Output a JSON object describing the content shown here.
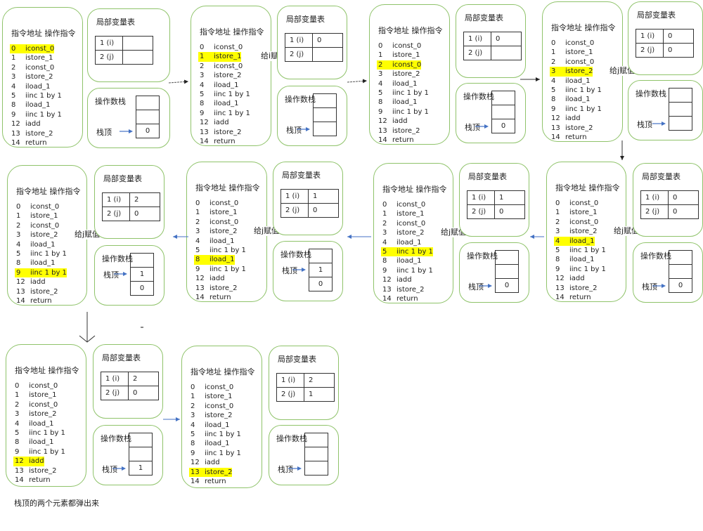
{
  "labels": {
    "code_header": "指令地址 操作指令",
    "locals_title": "局部变量表",
    "stack_title": "操作数栈",
    "stack_top": "栈顶",
    "slot_i": "1 (i)",
    "slot_j": "2 (j)"
  },
  "instructions": [
    {
      "addr": "0",
      "op": "iconst_0"
    },
    {
      "addr": "1",
      "op": "istore_1"
    },
    {
      "addr": "2",
      "op": "iconst_0"
    },
    {
      "addr": "3",
      "op": "istore_2"
    },
    {
      "addr": "4",
      "op": "iload_1"
    },
    {
      "addr": "5",
      "op": "iinc 1 by 1"
    },
    {
      "addr": "8",
      "op": "iload_1"
    },
    {
      "addr": "9",
      "op": "iinc 1 by 1"
    },
    {
      "addr": "12",
      "op": "iadd"
    },
    {
      "addr": "13",
      "op": "istore_2"
    },
    {
      "addr": "14",
      "op": "return"
    }
  ],
  "steps": [
    {
      "id": 1,
      "highlight": 0,
      "note": null,
      "i": "",
      "j": "",
      "stack": [
        "",
        "",
        "0"
      ],
      "top_row": 2
    },
    {
      "id": 2,
      "highlight": 1,
      "note": {
        "row": 1,
        "text": "给i赋值"
      },
      "i": "0",
      "j": "",
      "stack": [
        "",
        "",
        ""
      ],
      "top_row": 2
    },
    {
      "id": 3,
      "highlight": 2,
      "note": null,
      "i": "0",
      "j": "",
      "stack": [
        "",
        "",
        "0"
      ],
      "top_row": 2
    },
    {
      "id": 4,
      "highlight": 3,
      "note": {
        "row": 3,
        "text": "给j赋值"
      },
      "i": "0",
      "j": "0",
      "stack": [
        "",
        "",
        ""
      ],
      "top_row": 2
    },
    {
      "id": 5,
      "highlight": 4,
      "note": {
        "row": 3,
        "text": "给j赋值"
      },
      "i": "0",
      "j": "0",
      "stack": [
        "",
        "",
        "0"
      ],
      "top_row": 2
    },
    {
      "id": 6,
      "highlight": 5,
      "note": {
        "row": 3,
        "text": "给j赋值"
      },
      "i": "1",
      "j": "0",
      "stack": [
        "",
        "",
        "0"
      ],
      "top_row": 2
    },
    {
      "id": 7,
      "highlight": 6,
      "note": {
        "row": 3,
        "text": "给j赋值"
      },
      "i": "1",
      "j": "0",
      "stack": [
        "",
        "1",
        "0"
      ],
      "top_row": 1
    },
    {
      "id": 8,
      "highlight": 7,
      "note": {
        "row": 3,
        "text": "给j赋值"
      },
      "i": "2",
      "j": "0",
      "stack": [
        "",
        "1",
        "0"
      ],
      "top_row": 1
    },
    {
      "id": 9,
      "highlight": 8,
      "note": null,
      "i": "2",
      "j": "0",
      "stack": [
        "",
        "",
        "1"
      ],
      "top_row": 2
    },
    {
      "id": 10,
      "highlight": 9,
      "note": null,
      "i": "2",
      "j": "1",
      "stack": [
        "",
        "",
        ""
      ],
      "top_row": 2
    }
  ],
  "caption": "栈顶的两个元素都弹出来",
  "colors": {
    "panel_border": "#8fc36a",
    "highlight": "#ffff00",
    "arrow_blue": "#4472c4",
    "arrow_dark": "#333333"
  }
}
